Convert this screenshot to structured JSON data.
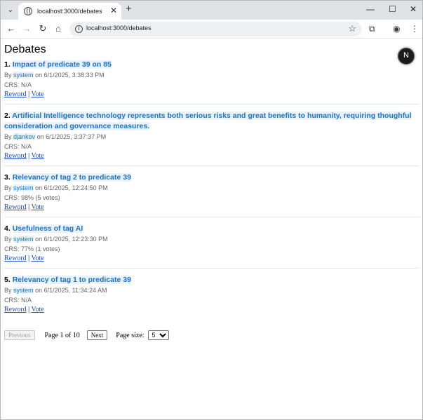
{
  "browser": {
    "tab_title": "localhost:3000/debates",
    "url": "localhost:3000/debates",
    "new_tab_symbol": "+",
    "close_symbol": "✕"
  },
  "page": {
    "title": "Debates"
  },
  "debates": [
    {
      "index": "1.",
      "title": "Impact of predicate 39 on 85",
      "by": "By",
      "author": "system",
      "date": "on 6/1/2025, 3:38:33 PM",
      "crs": "CRS: N/A",
      "reword": "Reword",
      "sep": "|",
      "vote": "Vote"
    },
    {
      "index": "2.",
      "title": "Artificial Intelligence technology represents both serious risks and great benefits to humanity, requiring thoughful consideration and governance measures.",
      "by": "By",
      "author": "djankov",
      "date": "on 6/1/2025, 3:37:37 PM",
      "crs": "CRS: N/A",
      "reword": "Reword",
      "sep": "|",
      "vote": "Vote"
    },
    {
      "index": "3.",
      "title": "Relevancy of tag 2 to predicate 39",
      "by": "By",
      "author": "system",
      "date": "on 6/1/2025, 12:24:50 PM",
      "crs": "CRS: 98% (5 votes)",
      "reword": "Reword",
      "sep": "|",
      "vote": "Vote"
    },
    {
      "index": "4.",
      "title": "Usefulness of tag AI",
      "by": "By",
      "author": "system",
      "date": "on 6/1/2025, 12:23:30 PM",
      "crs": "CRS: 77% (1 votes)",
      "reword": "Reword",
      "sep": "|",
      "vote": "Vote"
    },
    {
      "index": "5.",
      "title": "Relevancy of tag 1 to predicate 39",
      "by": "By",
      "author": "system",
      "date": "on 6/1/2025, 11:34:24 AM",
      "crs": "CRS: N/A",
      "reword": "Reword",
      "sep": "|",
      "vote": "Vote"
    }
  ],
  "pagination": {
    "previous_label": "Previous",
    "page_info": "Page 1 of 10",
    "next_label": "Next",
    "page_size_label": "Page size:",
    "page_size_value": "5"
  },
  "badge": {
    "letter": "N"
  },
  "icons": {
    "tab_search": "chevron-down-icon",
    "favicon": "globe-icon",
    "back": "arrow-left-icon",
    "forward": "arrow-right-icon",
    "reload": "reload-icon",
    "home": "home-icon",
    "site_info": "info-icon",
    "bookmark": "star-icon",
    "extensions": "puzzle-icon",
    "profile": "profile-icon",
    "menu": "kebab-menu-icon"
  },
  "colors": {
    "link": "#1a73c9",
    "action_link": "#1a4cbf",
    "meta_text": "#666666"
  }
}
